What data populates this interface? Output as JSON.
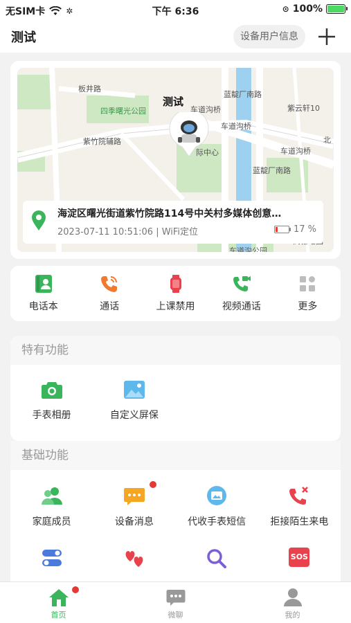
{
  "status_bar": {
    "carrier": "无SIM卡",
    "time": "下午 6:36",
    "battery": "100%"
  },
  "header": {
    "title": "测试",
    "device_info": "设备用户信息"
  },
  "map": {
    "watch_name": "测试",
    "labels": [
      "板井路",
      "四季曙光公园",
      "车道沟桥",
      "紫竹院辅路",
      "车道沟桥",
      "车道沟桥",
      "紫云轩10",
      "蓝靛厂南路",
      "蓝靛厂南路",
      "际中心",
      "车道沟公园",
      "高德地图",
      "北"
    ],
    "location": {
      "address": "海淀区曙光街道紫竹院路114号中关村多媒体创意…",
      "time_source": "2023-07-11 10:51:06 | WiFi定位",
      "battery": "17 %"
    }
  },
  "quick_actions": [
    {
      "label": "电话本",
      "icon": "contacts-icon"
    },
    {
      "label": "通话",
      "icon": "phone-icon"
    },
    {
      "label": "上课禁用",
      "icon": "watch-icon"
    },
    {
      "label": "视频通话",
      "icon": "video-call-icon"
    },
    {
      "label": "更多",
      "icon": "grid-icon"
    }
  ],
  "special": {
    "title": "特有功能",
    "items": [
      {
        "label": "手表相册",
        "icon": "camera-icon"
      },
      {
        "label": "自定义屏保",
        "icon": "picture-icon"
      }
    ]
  },
  "basic": {
    "title": "基础功能",
    "items": [
      {
        "label": "家庭成员",
        "icon": "family-icon"
      },
      {
        "label": "设备消息",
        "icon": "message-icon"
      },
      {
        "label": "代收手表短信",
        "icon": "sms-icon"
      },
      {
        "label": "拒接陌生来电",
        "icon": "reject-call-icon"
      }
    ],
    "row2_icons": [
      "toggle-icon",
      "hearts-icon",
      "search-icon",
      "sos-icon"
    ],
    "sos_text": "SOS"
  },
  "tabs": [
    {
      "label": "首页",
      "icon": "home-icon"
    },
    {
      "label": "微聊",
      "icon": "chat-icon"
    },
    {
      "label": "我的",
      "icon": "user-icon"
    }
  ],
  "colors": {
    "accent": "#3bb55c",
    "badge": "#e53935"
  }
}
